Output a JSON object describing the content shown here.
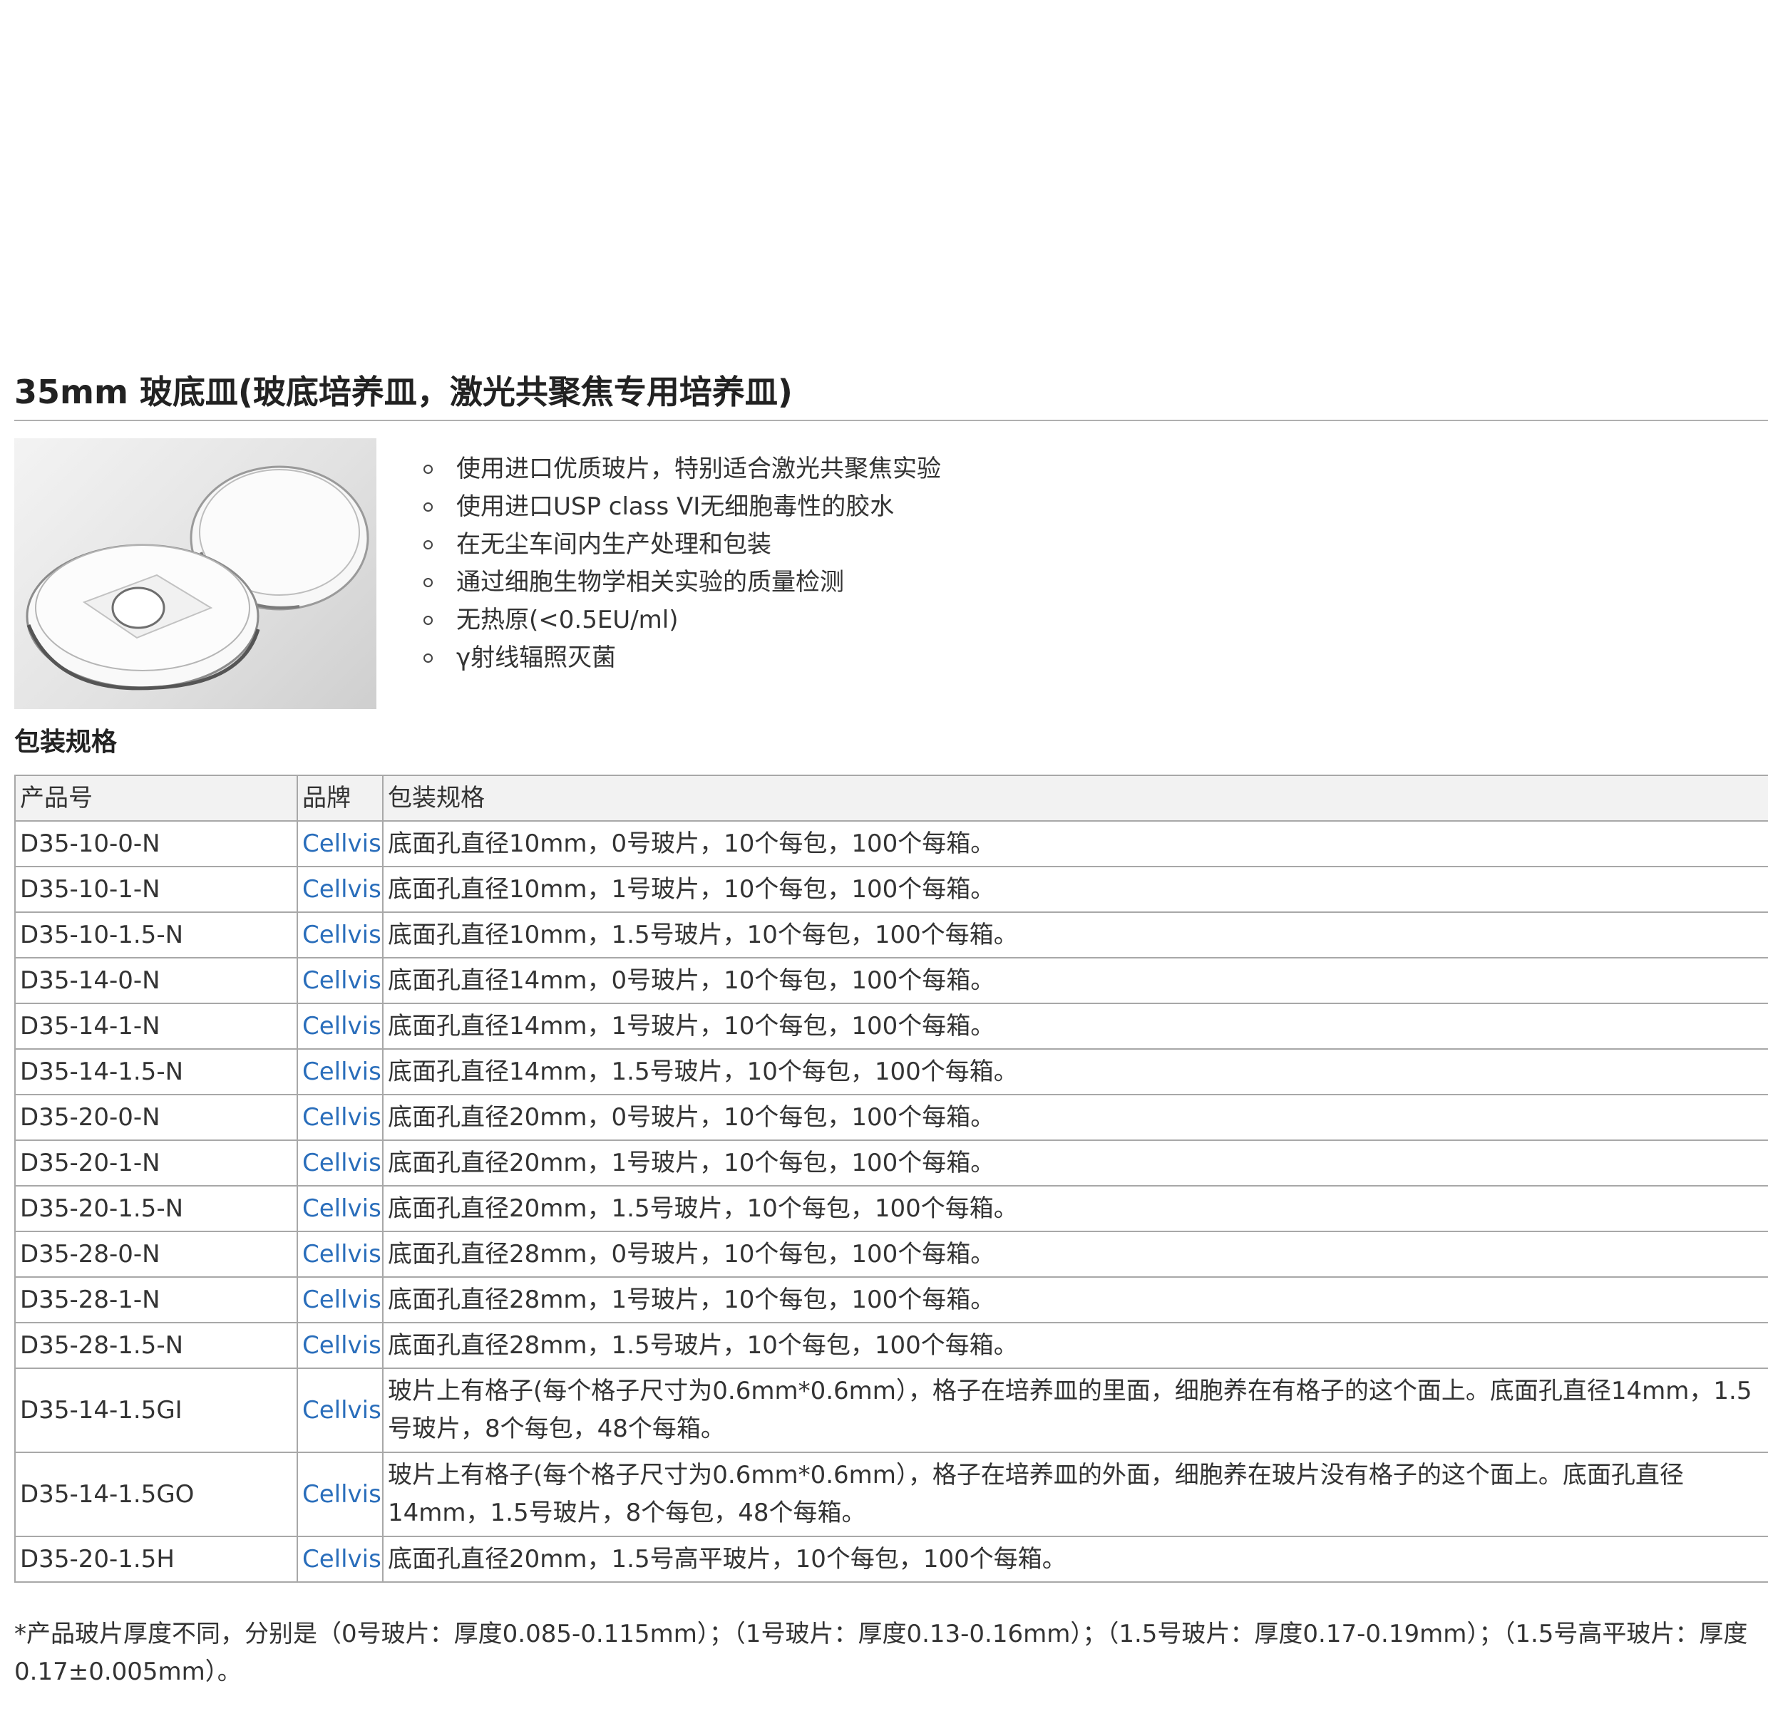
{
  "title": "35mm 玻底皿(玻底培养皿，激光共聚焦专用培养皿)",
  "features": [
    "使用进口优质玻片，特别适合激光共聚焦实验",
    "使用进口USP class VI无细胞毒性的胶水",
    "在无尘车间内生产处理和包装",
    "通过细胞生物学相关实验的质量检测",
    "无热原(<0.5EU/ml)",
    "γ射线辐照灭菌"
  ],
  "packaging": {
    "heading": "包装规格",
    "headers": [
      "产品号",
      "品牌",
      "包装规格"
    ],
    "rows": [
      {
        "code": "D35-10-0-N",
        "brand": "Cellvis",
        "desc": "底面孔直径10mm，0号玻片，10个每包，100个每箱。"
      },
      {
        "code": "D35-10-1-N",
        "brand": "Cellvis",
        "desc": "底面孔直径10mm，1号玻片，10个每包，100个每箱。"
      },
      {
        "code": "D35-10-1.5-N",
        "brand": "Cellvis",
        "desc": "底面孔直径10mm，1.5号玻片，10个每包，100个每箱。"
      },
      {
        "code": "D35-14-0-N",
        "brand": "Cellvis",
        "desc": "底面孔直径14mm，0号玻片，10个每包，100个每箱。"
      },
      {
        "code": "D35-14-1-N",
        "brand": "Cellvis",
        "desc": "底面孔直径14mm，1号玻片，10个每包，100个每箱。"
      },
      {
        "code": "D35-14-1.5-N",
        "brand": "Cellvis",
        "desc": "底面孔直径14mm，1.5号玻片，10个每包，100个每箱。"
      },
      {
        "code": "D35-20-0-N",
        "brand": "Cellvis",
        "desc": "底面孔直径20mm，0号玻片，10个每包，100个每箱。"
      },
      {
        "code": "D35-20-1-N",
        "brand": "Cellvis",
        "desc": "底面孔直径20mm，1号玻片，10个每包，100个每箱。"
      },
      {
        "code": "D35-20-1.5-N",
        "brand": "Cellvis",
        "desc": "底面孔直径20mm，1.5号玻片，10个每包，100个每箱。"
      },
      {
        "code": "D35-28-0-N",
        "brand": "Cellvis",
        "desc": "底面孔直径28mm，0号玻片，10个每包，100个每箱。"
      },
      {
        "code": "D35-28-1-N",
        "brand": "Cellvis",
        "desc": "底面孔直径28mm，1号玻片，10个每包，100个每箱。"
      },
      {
        "code": "D35-28-1.5-N",
        "brand": "Cellvis",
        "desc": "底面孔直径28mm，1.5号玻片，10个每包，100个每箱。"
      },
      {
        "code": "D35-14-1.5GI",
        "brand": "Cellvis",
        "desc": "玻片上有格子(每个格子尺寸为0.6mm*0.6mm），格子在培养皿的里面，细胞养在有格子的这个面上。底面孔直径14mm，1.5号玻片，8个每包，48个每箱。"
      },
      {
        "code": "D35-14-1.5GO",
        "brand": "Cellvis",
        "desc": "玻片上有格子(每个格子尺寸为0.6mm*0.6mm），格子在培养皿的外面，细胞养在玻片没有格子的这个面上。底面孔直径14mm，1.5号玻片，8个每包，48个每箱。"
      },
      {
        "code": "D35-20-1.5H",
        "brand": "Cellvis",
        "desc": "底面孔直径20mm，1.5号高平玻片，10个每包，100个每箱。"
      }
    ]
  },
  "footnote": "*产品玻片厚度不同，分别是（0号玻片：厚度0.085-0.115mm）；（1号玻片：厚度0.13-0.16mm）；（1.5号玻片：厚度0.17-0.19mm）；（1.5号高平玻片：厚度0.17±0.005mm）。"
}
